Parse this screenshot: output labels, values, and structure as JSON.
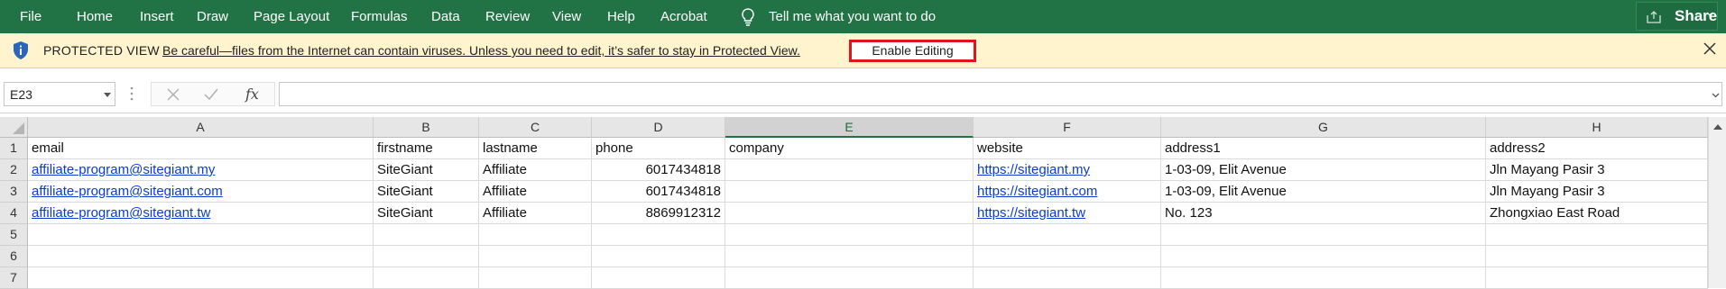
{
  "ribbon": {
    "tabs": [
      "File",
      "Home",
      "Insert",
      "Draw",
      "Page Layout",
      "Formulas",
      "Data",
      "Review",
      "View",
      "Help",
      "Acrobat"
    ],
    "tell_me": "Tell me what you want to do",
    "share": "Share",
    "bg_color": "#217346"
  },
  "protected_view": {
    "title": "PROTECTED VIEW",
    "message": "Be careful—files from the Internet can contain viruses. Unless you need to edit, it’s safer to stay in Protected View.",
    "enable_button": "Enable Editing",
    "highlight_color": "#e3131b"
  },
  "formula_bar": {
    "name_box": "E23",
    "fx_label": "fx",
    "formula": ""
  },
  "sheet": {
    "columns": [
      "A",
      "B",
      "C",
      "D",
      "E",
      "F",
      "G",
      "H"
    ],
    "selected_column": "E",
    "row_numbers": [
      "1",
      "2",
      "3",
      "4",
      "5",
      "6",
      "7"
    ],
    "rows": [
      [
        "email",
        "firstname",
        "lastname",
        "phone",
        "company",
        "website",
        "address1",
        "address2"
      ],
      [
        "affiliate-program@sitegiant.my",
        "SiteGiant",
        "Affiliate",
        "6017434818",
        "",
        "https://sitegiant.my",
        "1-03-09, Elit Avenue",
        "Jln Mayang Pasir 3"
      ],
      [
        "affiliate-program@sitegiant.com",
        "SiteGiant",
        "Affiliate",
        "6017434818",
        "",
        "https://sitegiant.com",
        "1-03-09, Elit Avenue",
        "Jln Mayang Pasir 3"
      ],
      [
        "affiliate-program@sitegiant.tw",
        "SiteGiant",
        "Affiliate",
        "8869912312",
        "",
        "https://sitegiant.tw",
        "No. 123",
        "Zhongxiao East Road"
      ],
      [
        "",
        "",
        "",
        "",
        "",
        "",
        "",
        ""
      ],
      [
        "",
        "",
        "",
        "",
        "",
        "",
        "",
        ""
      ],
      [
        "",
        "",
        "",
        "",
        "",
        "",
        "",
        ""
      ]
    ],
    "link_color": "#0b3bd6"
  }
}
